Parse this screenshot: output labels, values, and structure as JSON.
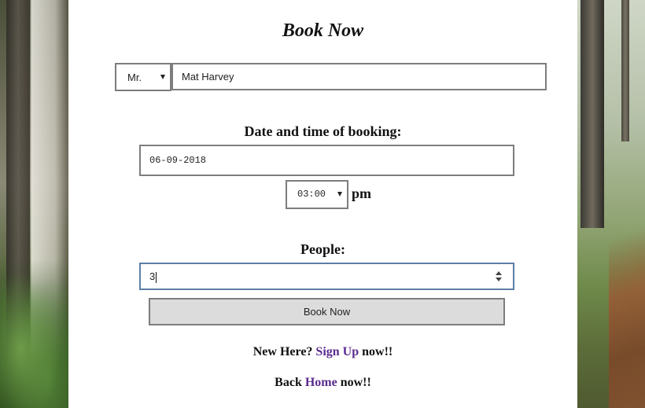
{
  "form": {
    "title": "Book Now",
    "salutation": "Mr.",
    "name_value": "Mat Harvey",
    "date_label": "Date and time of booking:",
    "date_value": "06-09-2018",
    "time_value": "03:00",
    "time_suffix": "pm",
    "people_label": "People:",
    "people_value": "3",
    "submit_label": "Book Now"
  },
  "footer": {
    "signup_prefix": "New Here?",
    "signup_link": "Sign Up",
    "signup_suffix": "now!!",
    "home_prefix": "Back",
    "home_link": "Home",
    "home_suffix": "now!!"
  },
  "colors": {
    "link": "#5b2b8f",
    "focus_border": "#5d7ea6",
    "button_bg": "#dcdcdc"
  }
}
